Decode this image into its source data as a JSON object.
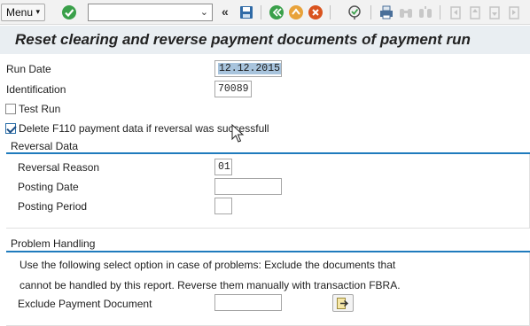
{
  "toolbar": {
    "menu_label": "Menu",
    "menu_caret": "▾",
    "command_value": "",
    "icons": [
      "check-icon",
      "double-chevron-icon",
      "save-icon",
      "back-icon",
      "exit-icon",
      "cancel-icon",
      "find-icon",
      "print-icon",
      "find-next-icon",
      "first-page-icon",
      "previous-page-icon",
      "next-page-icon",
      "last-page-icon"
    ],
    "chevrons": "«"
  },
  "title": "Reset clearing and reverse payment documents of payment run",
  "fields": {
    "run_date_label": "Run Date",
    "run_date_value": "12.12.2015",
    "identification_label": "Identification",
    "identification_value": "70089",
    "test_run_label": "Test Run",
    "test_run_checked": false,
    "delete_label": "Delete F110 payment data if reversal was successfull",
    "delete_checked": true
  },
  "reversal_data": {
    "title": "Reversal Data",
    "reason_label": "Reversal Reason",
    "reason_value": "01",
    "posting_date_label": "Posting Date",
    "posting_date_value": "",
    "posting_period_label": "Posting Period",
    "posting_period_value": ""
  },
  "problem_handling": {
    "title": "Problem Handling",
    "hint_line1": "Use the following select option in case of problems: Exclude the documents that",
    "hint_line2": "cannot be handled by this report. Reverse them manually with transaction FBRA.",
    "exclude_label": "Exclude Payment Document",
    "exclude_value": ""
  },
  "colors": {
    "accent": "#1f7bbd",
    "title_bg": "#e9eef2",
    "selection": "#a8c4dd"
  }
}
